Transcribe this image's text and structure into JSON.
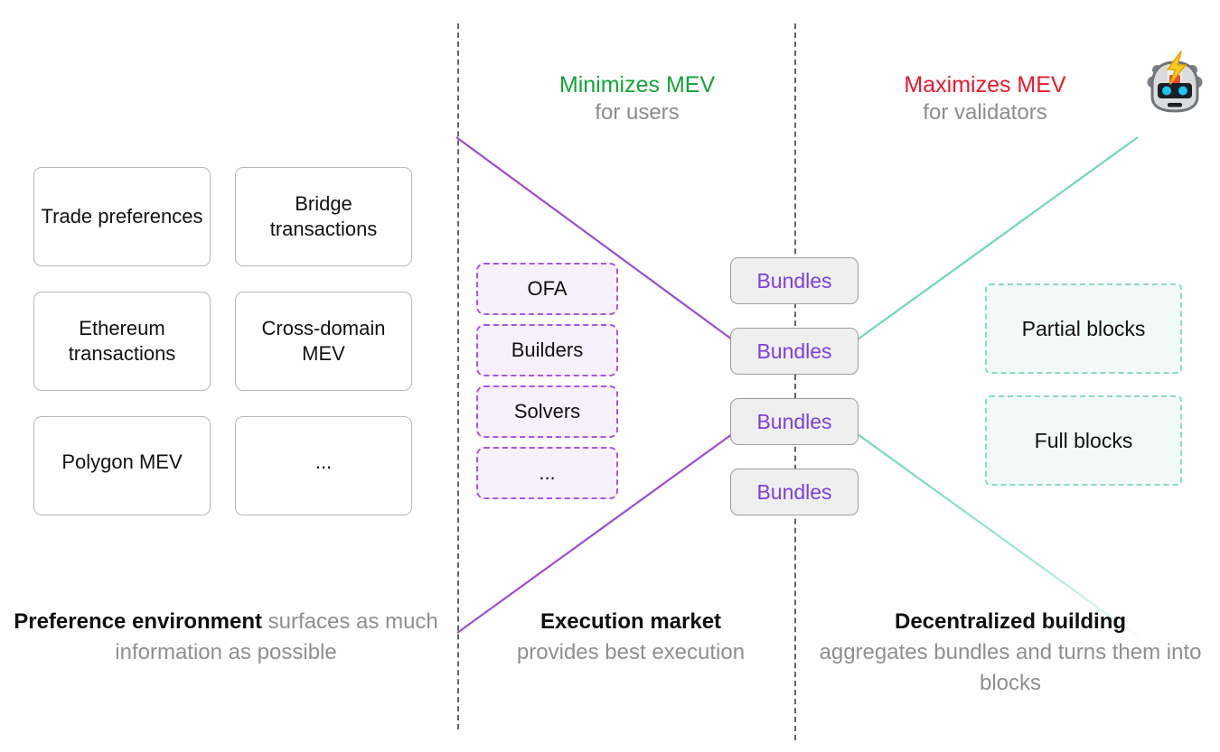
{
  "headers": {
    "middle": {
      "highlight": "Minimizes MEV",
      "highlight_color": "#13a438",
      "sub": "for users"
    },
    "right": {
      "highlight": "Maximizes MEV",
      "highlight_color": "#e8192c",
      "sub": "for validators"
    }
  },
  "badge": {
    "icon": "robot-with-lightning-icon",
    "alt": "Flashbots robot"
  },
  "preference_environment": {
    "cards": [
      {
        "label": "Trade preferences"
      },
      {
        "label": "Bridge transactions"
      },
      {
        "label": "Ethereum transactions"
      },
      {
        "label": "Cross-domain MEV"
      },
      {
        "label": "Polygon MEV"
      },
      {
        "label": "..."
      }
    ]
  },
  "execution_market": {
    "items": [
      {
        "label": "OFA"
      },
      {
        "label": "Builders"
      },
      {
        "label": "Solvers"
      },
      {
        "label": "..."
      }
    ]
  },
  "bundles": {
    "items": [
      {
        "label": "Bundles"
      },
      {
        "label": "Bundles"
      },
      {
        "label": "Bundles"
      },
      {
        "label": "Bundles"
      }
    ]
  },
  "blocks": {
    "items": [
      {
        "label": "Partial blocks"
      },
      {
        "label": "Full blocks"
      }
    ]
  },
  "captions": {
    "left": {
      "strong": "Preference environment",
      "rest": " surfaces as much information as possible"
    },
    "middle": {
      "strong": "Execution market",
      "rest": "provides best execution"
    },
    "right": {
      "strong": "Decentralized building",
      "rest": "aggregates bundles and turns them into blocks"
    }
  },
  "colors": {
    "purple_accent": "#9b4dd8",
    "green_accent": "#6fd8b4",
    "bundle_text": "#7d3fe0",
    "divider": "#4a4a4a",
    "muted_text": "#8f8f8f"
  }
}
